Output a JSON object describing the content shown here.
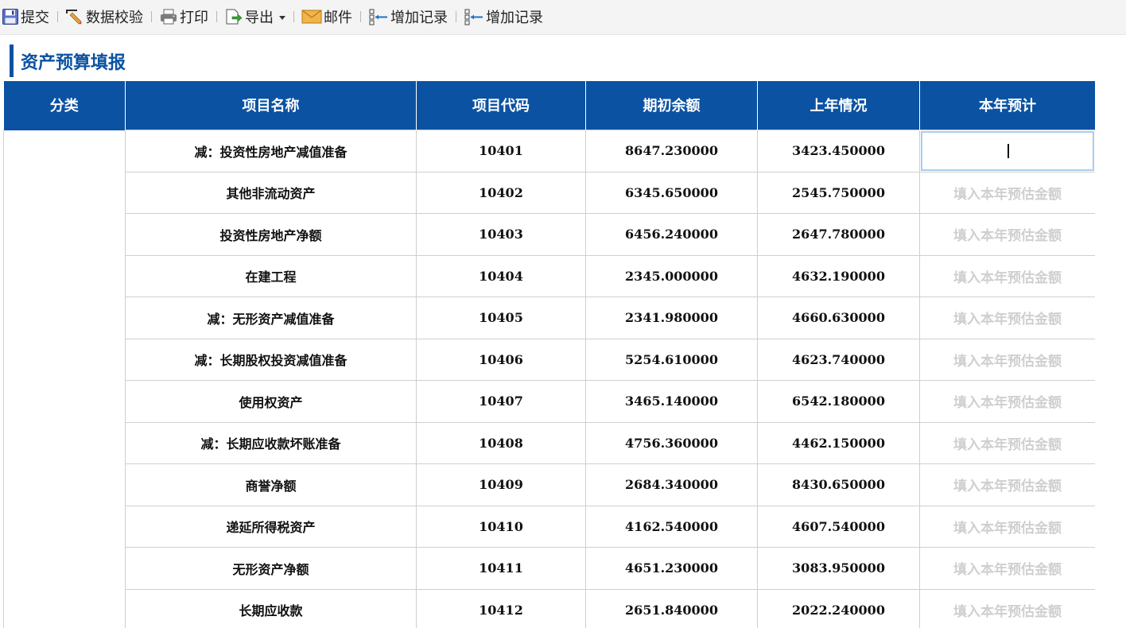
{
  "toolbar": {
    "items": [
      {
        "label": "提交",
        "icon": "save-icon"
      },
      {
        "label": "数据校验",
        "icon": "validate-icon"
      },
      {
        "label": "打印",
        "icon": "printer-icon"
      },
      {
        "label": "导出",
        "icon": "export-icon"
      },
      {
        "label": "邮件",
        "icon": "mail-icon"
      },
      {
        "label": "增加记录",
        "icon": "add-record-icon"
      },
      {
        "label": "增加记录",
        "icon": "add-record-icon"
      }
    ]
  },
  "page": {
    "title": "资产预算填报"
  },
  "table": {
    "headers": [
      "分类",
      "项目名称",
      "项目代码",
      "期初余额",
      "上年情况",
      "本年预计"
    ],
    "category": "",
    "input_placeholder": "填入本年预估金额",
    "rows": [
      {
        "name": "减：投资性房地产减值准备",
        "code": "10401",
        "opening": "8647.230000",
        "last_year": "3423.450000",
        "estimate": ""
      },
      {
        "name": "其他非流动资产",
        "code": "10402",
        "opening": "6345.650000",
        "last_year": "2545.750000",
        "estimate": ""
      },
      {
        "name": "投资性房地产净额",
        "code": "10403",
        "opening": "6456.240000",
        "last_year": "2647.780000",
        "estimate": ""
      },
      {
        "name": "在建工程",
        "code": "10404",
        "opening": "2345.000000",
        "last_year": "4632.190000",
        "estimate": ""
      },
      {
        "name": "减：无形资产减值准备",
        "code": "10405",
        "opening": "2341.980000",
        "last_year": "4660.630000",
        "estimate": ""
      },
      {
        "name": "减：长期股权投资减值准备",
        "code": "10406",
        "opening": "5254.610000",
        "last_year": "4623.740000",
        "estimate": ""
      },
      {
        "name": "使用权资产",
        "code": "10407",
        "opening": "3465.140000",
        "last_year": "6542.180000",
        "estimate": ""
      },
      {
        "name": "减：长期应收款坏账准备",
        "code": "10408",
        "opening": "4756.360000",
        "last_year": "4462.150000",
        "estimate": ""
      },
      {
        "name": "商誉净额",
        "code": "10409",
        "opening": "2684.340000",
        "last_year": "8430.650000",
        "estimate": ""
      },
      {
        "name": "递延所得税资产",
        "code": "10410",
        "opening": "4162.540000",
        "last_year": "4607.540000",
        "estimate": ""
      },
      {
        "name": "无形资产净额",
        "code": "10411",
        "opening": "4651.230000",
        "last_year": "3083.950000",
        "estimate": ""
      },
      {
        "name": "长期应收款",
        "code": "10412",
        "opening": "2651.840000",
        "last_year": "2022.240000",
        "estimate": ""
      }
    ]
  },
  "colors": {
    "header_bg": "#0b52a2",
    "title_accent": "#0b52a2",
    "placeholder": "#cfcfcf",
    "active_cell_border": "#a9cdee"
  }
}
